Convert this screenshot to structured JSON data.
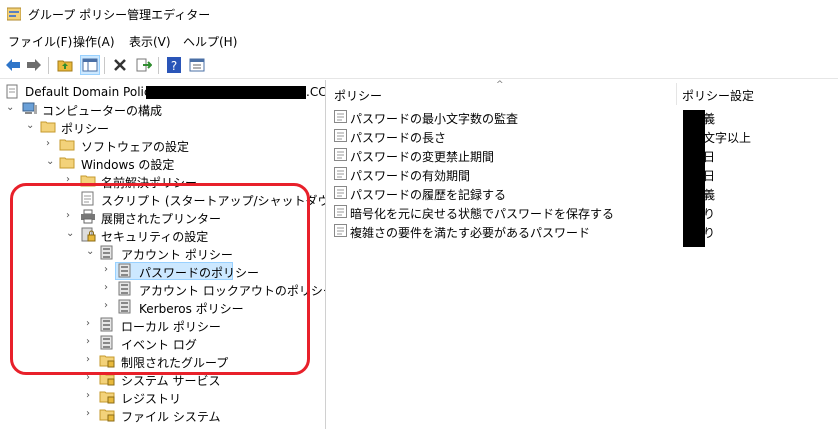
{
  "window": {
    "title": "グループ ポリシー管理エディター"
  },
  "menu": [
    "ファイル(F)",
    "操作(A)",
    "表示(V)",
    "ヘルプ(H)"
  ],
  "toolbar": {
    "icons": [
      "back-arrow-icon",
      "forward-arrow-icon",
      "up-folder-icon",
      "show-hide-tree-icon",
      "delete-icon",
      "export-list-icon",
      "help-icon",
      "properties-icon"
    ]
  },
  "tree": {
    "root": "Default Domain Policy",
    "root_suffix": ".CC",
    "items": [
      {
        "label": "コンピューターの構成"
      },
      {
        "label": "ポリシー"
      },
      {
        "label": "ソフトウェアの設定"
      },
      {
        "label": "Windows の設定"
      },
      {
        "label": "名前解決ポリシー"
      },
      {
        "label": "スクリプト (スタートアップ/シャットダウン)"
      },
      {
        "label": "展開されたプリンター"
      },
      {
        "label": "セキュリティの設定"
      },
      {
        "label": "アカウント ポリシー"
      },
      {
        "label": "パスワードのポリシー"
      },
      {
        "label": "アカウント ロックアウトのポリシー"
      },
      {
        "label": "Kerberos ポリシー"
      },
      {
        "label": "ローカル ポリシー"
      },
      {
        "label": "イベント ログ"
      },
      {
        "label": "制限されたグループ"
      },
      {
        "label": "システム サービス"
      },
      {
        "label": "レジストリ"
      },
      {
        "label": "ファイル システム"
      }
    ]
  },
  "list": {
    "columns": [
      "ポリシー",
      "ポリシー設定"
    ],
    "rows": [
      {
        "policy": "パスワードの最小文字数の監査",
        "value": "義"
      },
      {
        "policy": "パスワードの長さ",
        "value": "文字以上"
      },
      {
        "policy": "パスワードの変更禁止期間",
        "value": "日"
      },
      {
        "policy": "パスワードの有効期間",
        "value": "日"
      },
      {
        "policy": "パスワードの履歴を記録する",
        "value": "義"
      },
      {
        "policy": "暗号化を元に戻せる状態でパスワードを保存する",
        "value": "り"
      },
      {
        "policy": "複雑さの要件を満たす必要があるパスワード",
        "value": "り"
      }
    ]
  },
  "colors": {
    "highlight": "#cce8ff",
    "annotation": "#e8202a"
  }
}
